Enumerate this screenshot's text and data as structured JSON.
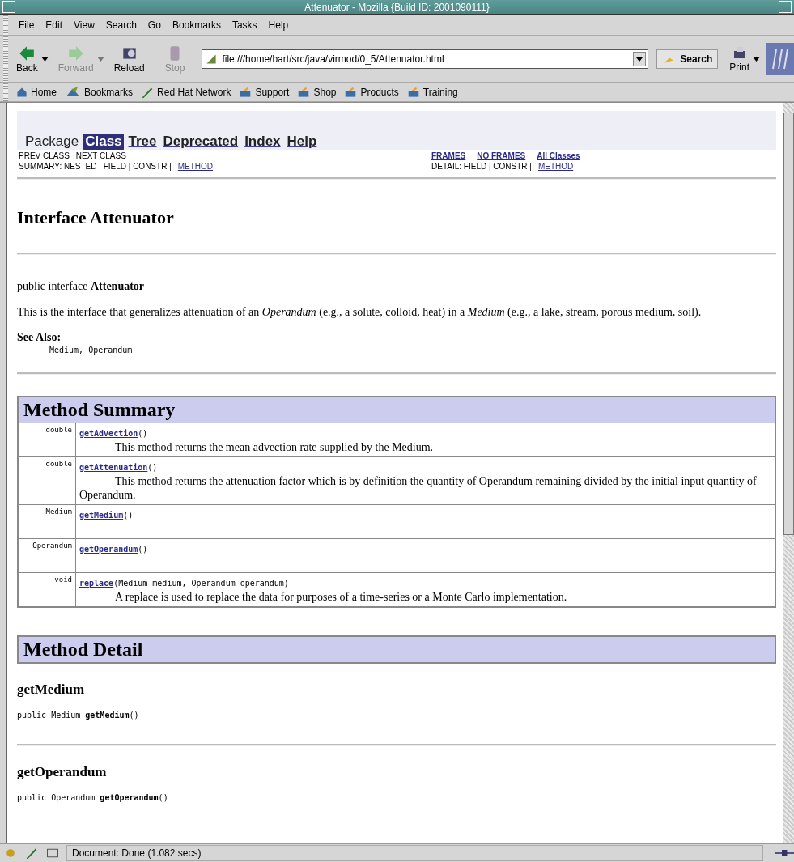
{
  "window": {
    "title": "Attenuator - Mozilla {Build ID: 2001090111}"
  },
  "menu": [
    "File",
    "Edit",
    "View",
    "Search",
    "Go",
    "Bookmarks",
    "Tasks",
    "Help"
  ],
  "nav_buttons": [
    {
      "label": "Back",
      "kind": "back",
      "disabled": false,
      "dropdown": true
    },
    {
      "label": "Forward",
      "kind": "forward",
      "disabled": true,
      "dropdown": true
    },
    {
      "label": "Reload",
      "kind": "reload",
      "disabled": false,
      "dropdown": false
    },
    {
      "label": "Stop",
      "kind": "stop",
      "disabled": true,
      "dropdown": false
    }
  ],
  "url": "file:///home/bart/src/java/virmod/0_5/Attenuator.html",
  "search_button": "Search",
  "print_button": "Print",
  "personal_bar": [
    {
      "label": "Home",
      "kind": "home"
    },
    {
      "label": "Bookmarks",
      "kind": "bookmarks"
    },
    {
      "label": "Red Hat Network",
      "kind": "pen"
    },
    {
      "label": "Support",
      "kind": "folder"
    },
    {
      "label": "Shop",
      "kind": "folder"
    },
    {
      "label": "Products",
      "kind": "folder"
    },
    {
      "label": "Training",
      "kind": "folder"
    }
  ],
  "doc_nav": [
    {
      "label": "Package",
      "linked": false,
      "selected": false
    },
    {
      "label": "Class",
      "linked": false,
      "selected": true
    },
    {
      "label": "Tree",
      "linked": true,
      "selected": false
    },
    {
      "label": "Deprecated",
      "linked": true,
      "selected": false
    },
    {
      "label": "Index",
      "linked": true,
      "selected": false
    },
    {
      "label": "Help",
      "linked": true,
      "selected": false
    }
  ],
  "sub_nav": {
    "left": [
      "PREV CLASS",
      "NEXT CLASS"
    ],
    "summary": {
      "text": "SUMMARY: NESTED | FIELD | CONSTR |",
      "link": "METHOD"
    },
    "right": [
      "FRAMES",
      "NO FRAMES",
      "All Classes"
    ],
    "detail": {
      "text": "DETAIL: FIELD | CONSTR |",
      "link": "METHOD"
    }
  },
  "heading": "Interface Attenuator",
  "declaration": "public interface **Attenuator**",
  "description": "This is the interface that generalizes attenuation of an *Operandum* (e.g., a solute, colloid, heat) in a *Medium* (e.g., a lake, stream, porous medium, soil).",
  "see_also": {
    "label": "See Also:",
    "items": "Medium, Operandum"
  },
  "method_summary": {
    "title": "Method Summary",
    "rows": [
      {
        "type": "double",
        "name": "getAdvection",
        "params": "()",
        "description": "This method returns the mean advection rate supplied by the Medium."
      },
      {
        "type": "double",
        "name": "getAttenuation",
        "params": "()",
        "description": "This method returns the attenuation factor which is by definition the quantity of Operandum remaining divided by the initial input quantity of Operandum."
      },
      {
        "type": "Medium",
        "name": "getMedium",
        "params": "()"
      },
      {
        "type": "Operandum",
        "name": "getOperandum",
        "params": "()"
      },
      {
        "type": "void",
        "name": "replace",
        "params": "(Medium medium, Operandum operandum)",
        "description": "A replace is used to replace the data for purposes of a time-series or a Monte Carlo implementation."
      }
    ]
  },
  "method_detail": {
    "title": "Method Detail",
    "entries": [
      {
        "name": "getMedium",
        "signature": "public Medium **getMedium**()"
      },
      {
        "name": "getOperandum",
        "signature": "public Operandum **getOperandum**()"
      }
    ]
  },
  "status_bar": {
    "text": "Document: Done (1.082 secs)"
  }
}
